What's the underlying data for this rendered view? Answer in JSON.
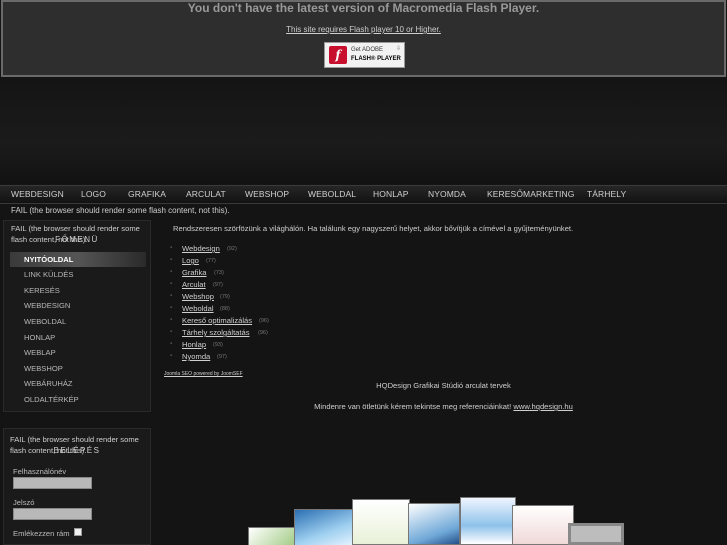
{
  "flash": {
    "title": "You don't have the latest version of Macromedia Flash Player.",
    "link": "This site requires Flash player 10 or Higher.",
    "badge_line1": "Get ADOBE",
    "badge_line2": "FLASH® PLAYER",
    "badge_logo": "f",
    "badge_icon": "download-arrow-icon"
  },
  "topnav": [
    "WEBDESIGN",
    "LOGO",
    "GRAFIKA",
    "ARCULAT",
    "WEBSHOP",
    "WEBOLDAL",
    "HONLAP",
    "NYOMDA",
    "KERESŐMARKETING",
    "TÁRHELY"
  ],
  "fail_text": "FAIL (the browser should render some flash content, not this).",
  "left_menu": {
    "heading": "FŐMENÜ",
    "items": [
      "NYITÓOLDAL",
      "LINK KÜLDÉS",
      "KERESÉS",
      "WEBDESIGN",
      "WEBOLDAL",
      "HONLAP",
      "WEBLAP",
      "WEBSHOP",
      "WEBÁRUHÁZ",
      "OLDALTÉRKÉP"
    ],
    "active_index": 0
  },
  "login": {
    "heading": "BELÉPÉS",
    "username_label": "Felhasználónév",
    "password_label": "Jelszó",
    "remember_label": "Emlékezzen rám"
  },
  "main": {
    "intro": "Rendszeresen szörfözünk a világhálón. Ha találunk egy nagyszerű helyet, akkor bővítjük a címével a gyűjteményünket.",
    "categories": [
      {
        "name": "Webdesign",
        "count": "(92)"
      },
      {
        "name": "Logo",
        "count": "(77)"
      },
      {
        "name": "Grafika",
        "count": "(73)"
      },
      {
        "name": "Arculat",
        "count": "(97)"
      },
      {
        "name": "Webshop",
        "count": "(79)"
      },
      {
        "name": "Weboldal",
        "count": "(88)"
      },
      {
        "name": "Kereső optimalizálás",
        "count": "(96)"
      },
      {
        "name": "Tárhely szolgáltatás",
        "count": "(96)"
      },
      {
        "name": "Honlap",
        "count": "(93)"
      },
      {
        "name": "Nyomda",
        "count": "(97)"
      }
    ],
    "sef_link": "Joomla SEO powered by JoomSEF",
    "studio_text": "HQDesign Grafikai Stúdió arculat tervek",
    "ref_text": "Mindenre van ötletünk kérem tekintse meg referenciáinkat!",
    "ref_link": "www.hqdesign.hu"
  }
}
